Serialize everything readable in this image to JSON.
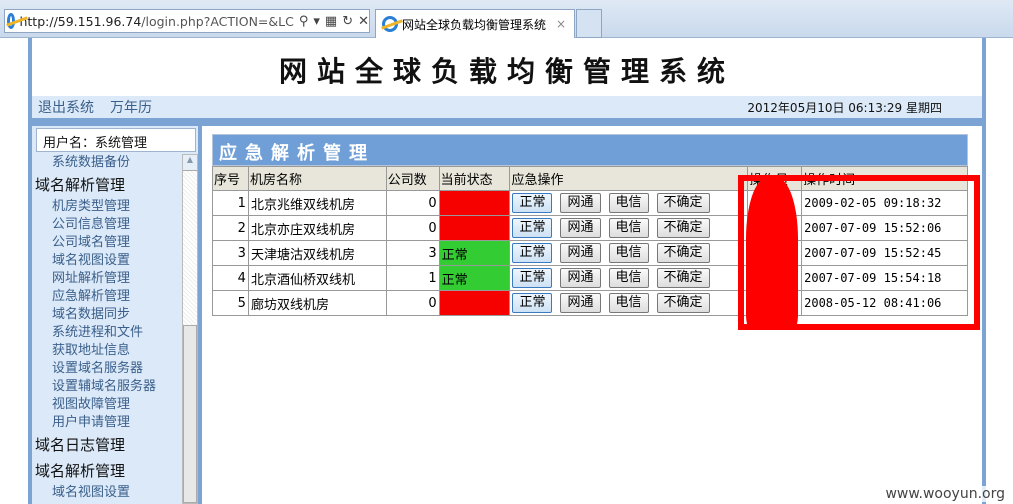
{
  "browser": {
    "url_host": "http://59.151.96.74",
    "url_path": "/login.php?ACTION=&LC",
    "tab_title": "网站全球负载均衡管理系统",
    "tab_close": "×"
  },
  "page": {
    "title": "网站全球负载均衡管理系统",
    "nav": [
      "退出系统",
      "万年历"
    ],
    "clock": "2012年05月10日 06:13:29 星期四"
  },
  "sidebar": {
    "user": "用户名：系统管理",
    "items": [
      {
        "type": "sub",
        "label": "系统数据备份"
      },
      {
        "type": "group",
        "label": "域名解析管理"
      },
      {
        "type": "sub",
        "label": "机房类型管理"
      },
      {
        "type": "sub",
        "label": "公司信息管理"
      },
      {
        "type": "sub",
        "label": "公司域名管理"
      },
      {
        "type": "sub",
        "label": "域名视图设置"
      },
      {
        "type": "sub",
        "label": "网址解析管理"
      },
      {
        "type": "sub",
        "label": "应急解析管理"
      },
      {
        "type": "sub",
        "label": "域名数据同步"
      },
      {
        "type": "sub",
        "label": "系统进程和文件"
      },
      {
        "type": "sub",
        "label": "获取地址信息"
      },
      {
        "type": "sub",
        "label": "设置域名服务器"
      },
      {
        "type": "sub",
        "label": "设置辅域名服务器"
      },
      {
        "type": "sub",
        "label": "视图故障管理"
      },
      {
        "type": "sub",
        "label": "用户申请管理"
      },
      {
        "type": "group",
        "label": "域名日志管理"
      },
      {
        "type": "group",
        "label": "域名解析管理"
      },
      {
        "type": "sub",
        "label": "域名视图设置"
      }
    ]
  },
  "main": {
    "heading": "应急解析管理",
    "columns": [
      "序号",
      "机房名称",
      "公司数",
      "当前状态",
      "应急操作",
      "操作员",
      "操作时间"
    ],
    "actions": [
      "正常",
      "网通",
      "电信",
      "不确定"
    ],
    "rows": [
      {
        "no": "1",
        "name": "北京兆维双线机房",
        "count": "0",
        "status": "",
        "status_color": "#f60000",
        "operator": "",
        "time": "2009-02-05 09:18:32"
      },
      {
        "no": "2",
        "name": "北京亦庄双线机房",
        "count": "0",
        "status": "",
        "status_color": "#f60000",
        "operator": "",
        "time": "2007-07-09 15:52:06"
      },
      {
        "no": "3",
        "name": "天津塘沽双线机房",
        "count": "3",
        "status": "正常",
        "status_color": "#33cc33",
        "operator": "",
        "time": "2007-07-09 15:52:45"
      },
      {
        "no": "4",
        "name": "北京酒仙桥双线机",
        "count": "1",
        "status": "正常",
        "status_color": "#33cc33",
        "operator": "",
        "time": "2007-07-09 15:54:18"
      },
      {
        "no": "5",
        "name": "廊坊双线机房",
        "count": "0",
        "status": "",
        "status_color": "#f60000",
        "operator": "",
        "time": "2008-05-12 08:41:06"
      }
    ]
  },
  "watermark": "www.wooyun.org"
}
